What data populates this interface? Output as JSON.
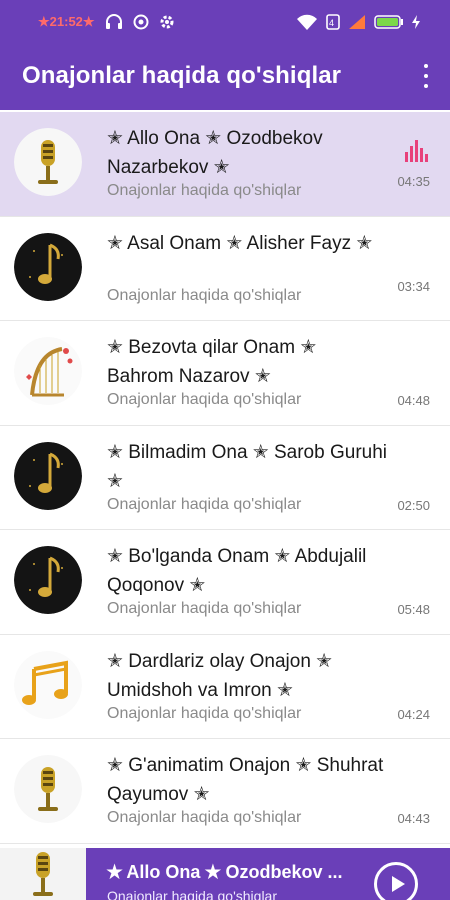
{
  "status": {
    "time": "★21:52★",
    "battery_color": "#7cd84a"
  },
  "header": {
    "title": "Onajonlar haqida qo'shiqlar"
  },
  "songs": [
    {
      "title": "✭ Allo Ona ✭ Ozodbekov Nazarbekov ✭",
      "subtitle": "Onajonlar haqida qo'shiqlar",
      "duration": "04:35",
      "thumb_icon": "microphone-icon",
      "active": true
    },
    {
      "title": "✭ Asal Onam ✭ Alisher Fayz ✭",
      "subtitle": "Onajonlar haqida qo'shiqlar",
      "duration": "03:34",
      "thumb_icon": "music-note-icon"
    },
    {
      "title": "✭ Bezovta qilar Onam ✭ Bahrom Nazarov ✭",
      "subtitle": "Onajonlar haqida qo'shiqlar",
      "duration": "04:48",
      "thumb_icon": "harp-icon"
    },
    {
      "title": "✭ Bilmadim Ona ✭ Sarob Guruhi ✭",
      "subtitle": "Onajonlar haqida qo'shiqlar",
      "duration": "02:50",
      "thumb_icon": "music-note-icon"
    },
    {
      "title": "✭ Bo'lganda Onam ✭ Abdujalil Qoqonov ✭",
      "subtitle": "Onajonlar haqida qo'shiqlar",
      "duration": "05:48",
      "thumb_icon": "music-note-icon"
    },
    {
      "title": "✭ Dardlariz olay Onajon ✭ Umidshoh va Imron ✭",
      "subtitle": "Onajonlar haqida qo'shiqlar",
      "duration": "04:24",
      "thumb_icon": "gold-notes-icon"
    },
    {
      "title": "✭ G'animatim Onajon ✭ Shuhrat Qayumov ✭",
      "subtitle": "Onajonlar haqida qo'shiqlar",
      "duration": "04:43",
      "thumb_icon": "microphone-icon"
    }
  ],
  "player": {
    "title": "✭ Allo Ona ✭ Ozodbekov ...",
    "subtitle": "Onajonlar haqida qo'shiqlar"
  },
  "colors": {
    "primary": "#6a3fb8",
    "active_row": "#e2d9f1",
    "equalizer": "#e8407a"
  }
}
